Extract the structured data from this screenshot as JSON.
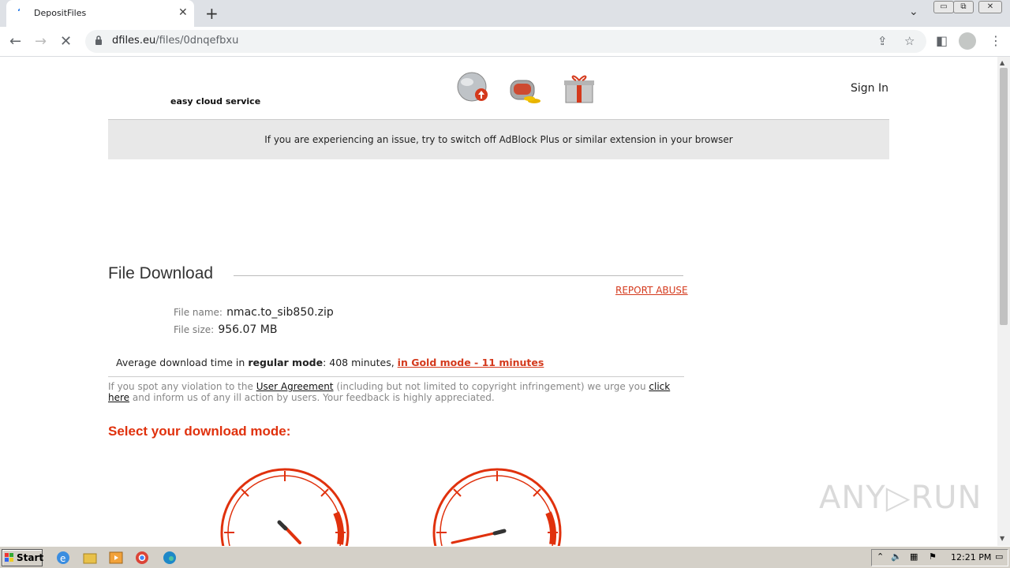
{
  "browser": {
    "tab_title": "DepositFiles",
    "url_host": "dfiles.eu",
    "url_path": "/files/0dnqefbxu"
  },
  "header": {
    "tagline": "easy cloud service",
    "sign_in": "Sign In"
  },
  "notice": "If you are experiencing an issue, try to switch off AdBlock Plus or similar extension in your browser",
  "file_download": {
    "title": "File Download",
    "report_abuse": "REPORT ABUSE",
    "file_name_label": "File name:",
    "file_name": "nmac.to_sib850.zip",
    "file_size_label": "File size:",
    "file_size": "956.07 MB",
    "avg_prefix": "Average download time in",
    "regular_mode": "regular mode",
    "regular_time": ": 408 minutes,",
    "gold_mode": "in Gold mode - 11 minutes"
  },
  "violation": {
    "part1": "If you spot any violation to the",
    "user_agreement": "User Agreement",
    "part2": "(including but not limited to copyright infringement) we urge you",
    "click_here": "click here",
    "part3": "and inform us of any ill action by users. Your feedback is highly appreciated."
  },
  "select_mode": "Select your download mode:",
  "taskbar": {
    "start": "Start",
    "clock": "12:21 PM"
  },
  "watermark": "ANY▷RUN",
  "colors": {
    "accent": "#d4391c",
    "gauge": "#e0310d"
  }
}
